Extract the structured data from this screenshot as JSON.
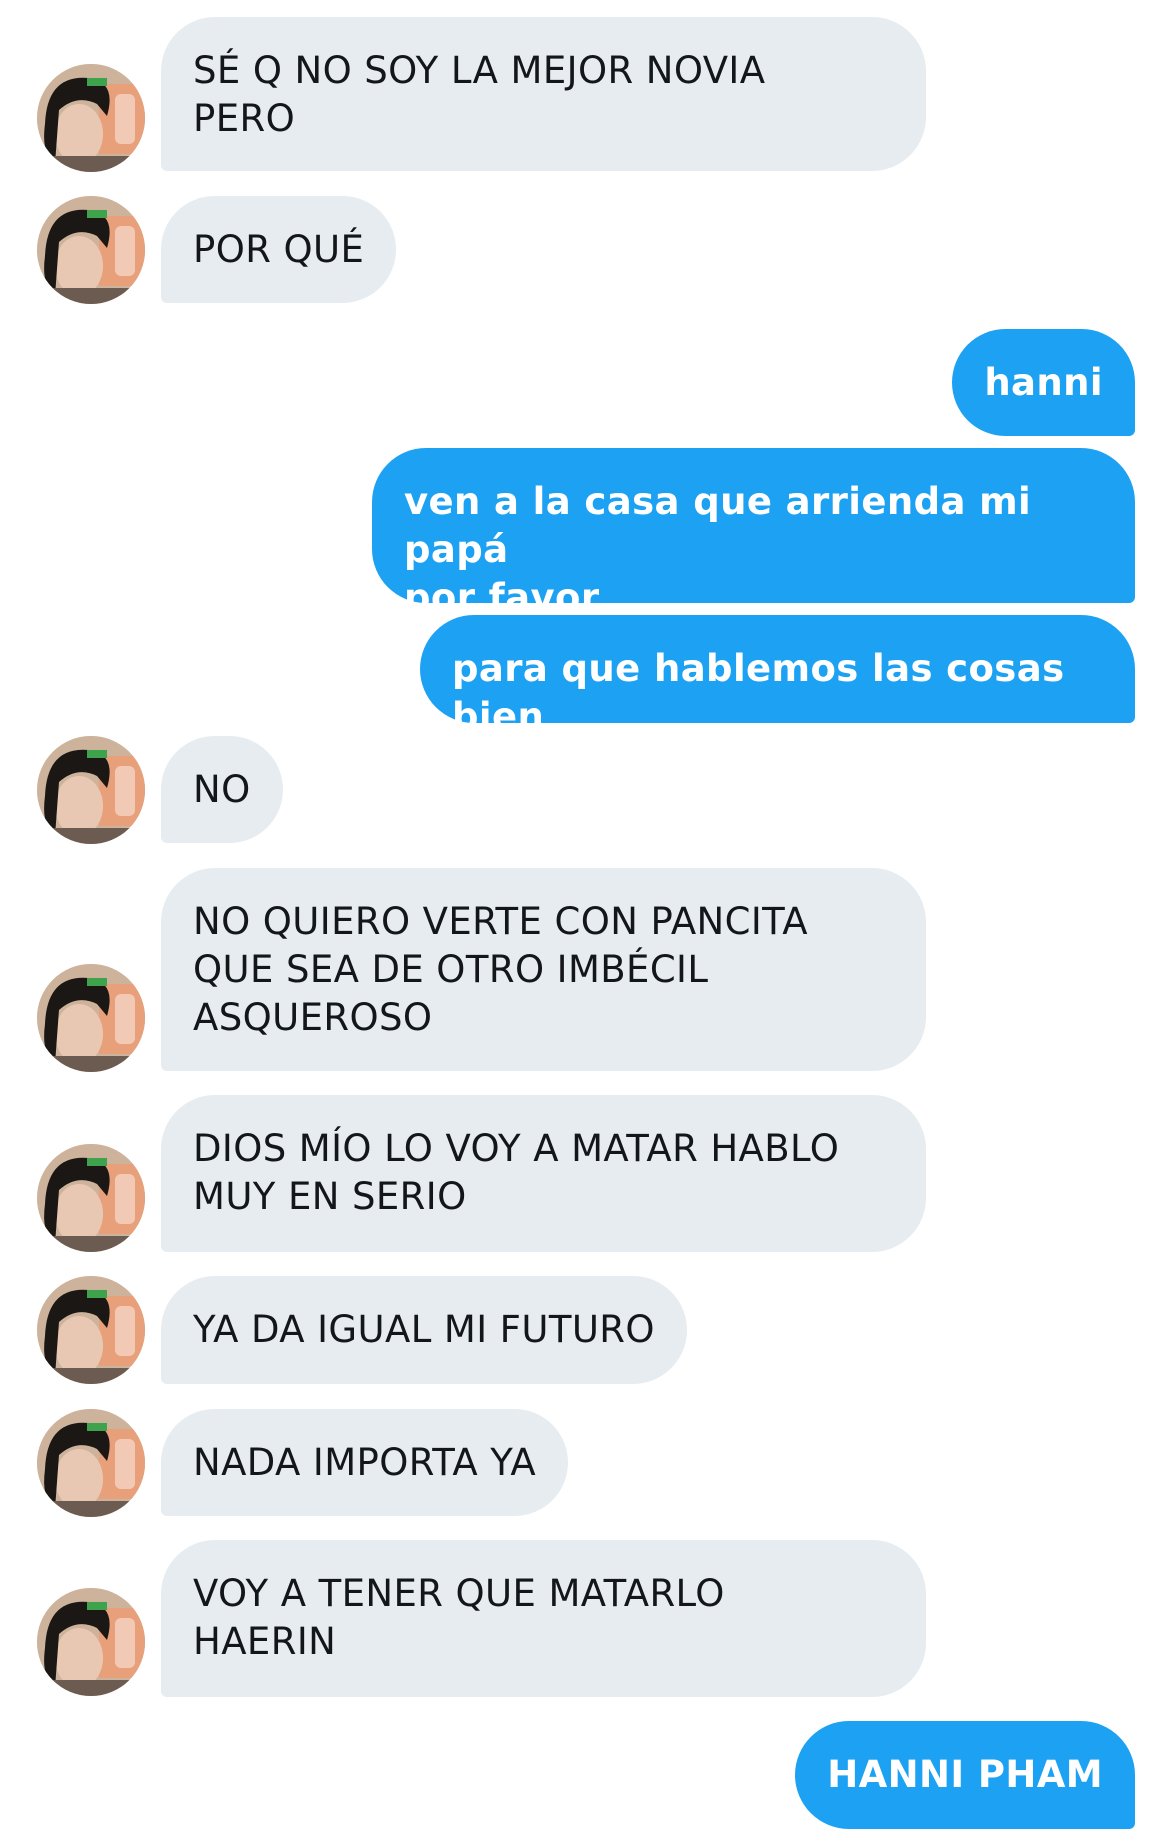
{
  "conversation": {
    "messages": [
      {
        "from": "other",
        "text": "SÉ Q NO SOY LA MEJOR NOVIA\nPERO"
      },
      {
        "from": "other",
        "text": "POR QUÉ"
      },
      {
        "from": "me",
        "text": "hanni"
      },
      {
        "from": "me",
        "text": "ven a la casa que arrienda mi papá\npor favor"
      },
      {
        "from": "me",
        "text": "para que hablemos las cosas bien"
      },
      {
        "from": "other",
        "text": "NO"
      },
      {
        "from": "other",
        "text": "NO QUIERO VERTE CON PANCITA\nQUE SEA DE OTRO IMBÉCIL\nASQUEROSO"
      },
      {
        "from": "other",
        "text": "DIOS MÍO LO VOY A MATAR HABLO\nMUY EN SERIO"
      },
      {
        "from": "other",
        "text": "YA DA IGUAL MI FUTURO"
      },
      {
        "from": "other",
        "text": "NADA IMPORTA YA"
      },
      {
        "from": "other",
        "text": "VOY A TENER QUE MATARLO\nHAERIN"
      },
      {
        "from": "me",
        "text": "HANNI PHAM"
      }
    ],
    "colors": {
      "incoming_bubble": "#e6ecf0",
      "outgoing_bubble": "#1da1f2",
      "incoming_text": "#14171a",
      "outgoing_text": "#ffffff"
    },
    "avatar_icon": "profile-photo-avatar"
  }
}
